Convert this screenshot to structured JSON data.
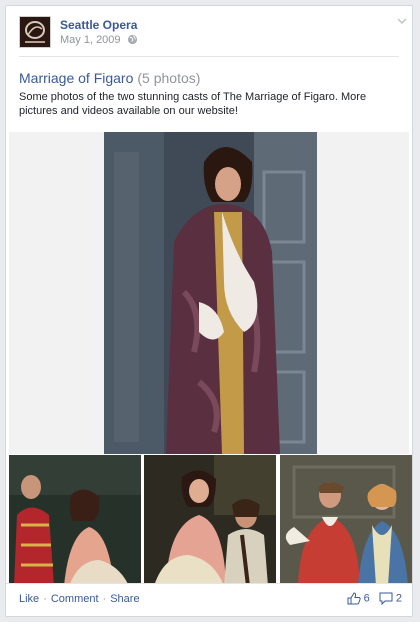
{
  "post": {
    "page_name": "Seattle Opera",
    "date": "May 1, 2009",
    "privacy_icon": "globe-icon",
    "album_title": "Marriage of Figaro",
    "photo_count": "(5 photos)",
    "description": "Some photos of the two stunning casts of The Marriage of Figaro. More pictures and videos available on our website!"
  },
  "footer": {
    "like_label": "Like",
    "comment_label": "Comment",
    "share_label": "Share",
    "separator": "·",
    "likes_count": "6",
    "comments_count": "2"
  },
  "colors": {
    "link": "#3b5998",
    "muted": "#90949c",
    "background": "#e9ebee"
  }
}
